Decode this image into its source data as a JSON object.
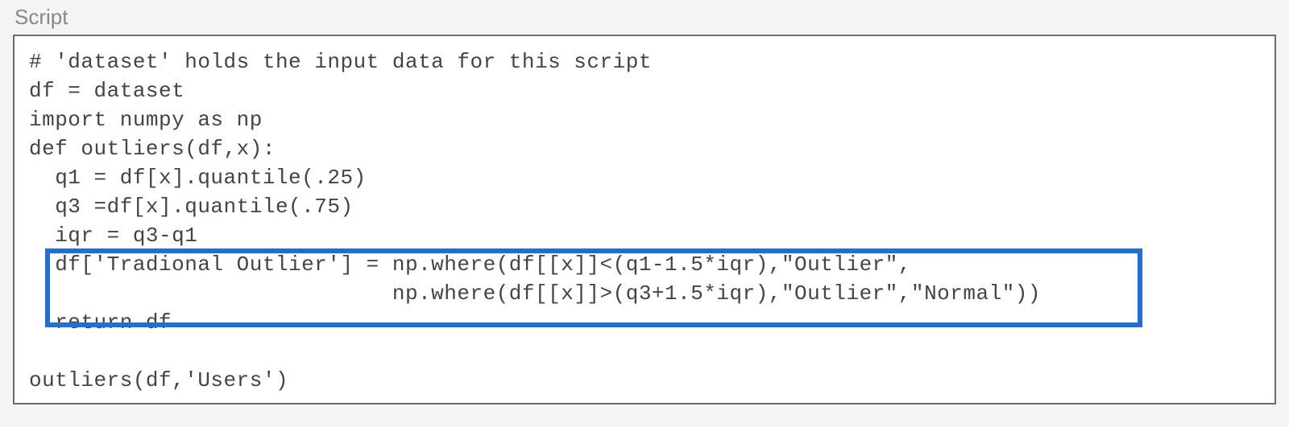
{
  "panel": {
    "label": "Script"
  },
  "code": {
    "lines": [
      "# 'dataset' holds the input data for this script",
      "df = dataset",
      "import numpy as np",
      "def outliers(df,x):",
      "  q1 = df[x].quantile(.25)",
      "  q3 =df[x].quantile(.75)",
      "  iqr = q3-q1",
      "  df['Tradional Outlier'] = np.where(df[[x]]<(q1-1.5*iqr),\"Outlier\",",
      "                            np.where(df[[x]]>(q3+1.5*iqr),\"Outlier\",\"Normal\"))",
      "  return df",
      "",
      "outliers(df,'Users')"
    ]
  },
  "highlight": {
    "description": "blue selection box around np.where outlier assignment lines"
  }
}
